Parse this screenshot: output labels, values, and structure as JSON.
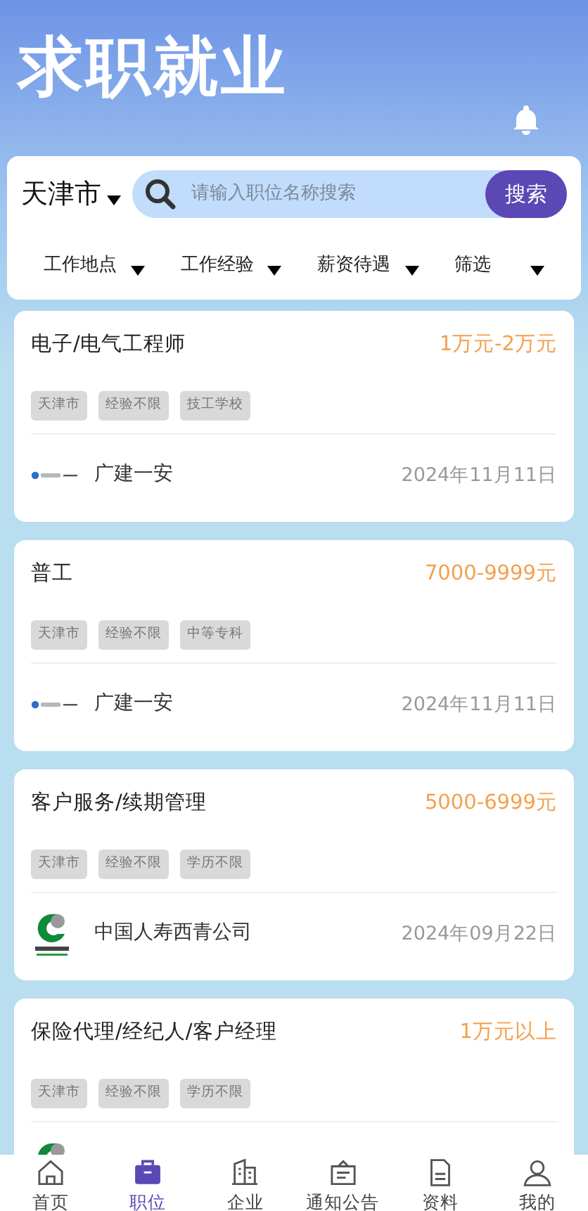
{
  "header": {
    "title": "求职就业"
  },
  "search": {
    "city": "天津市",
    "placeholder": "请输入职位名称搜索",
    "button": "搜索"
  },
  "filters": [
    {
      "label": "工作地点"
    },
    {
      "label": "工作经验"
    },
    {
      "label": "薪资待遇"
    },
    {
      "label": "筛选"
    }
  ],
  "jobs": [
    {
      "title": "电子/电气工程师",
      "salary": "1万元-2万元",
      "tags": [
        "天津市",
        "经验不限",
        "技工学校"
      ],
      "kind": "guangjian",
      "company": "广建一安",
      "date": "2024年11月11日"
    },
    {
      "title": "普工",
      "salary": "7000-9999元",
      "tags": [
        "天津市",
        "经验不限",
        "中等专科"
      ],
      "kind": "guangjian",
      "company": "广建一安",
      "date": "2024年11月11日"
    },
    {
      "title": "客户服务/续期管理",
      "salary": "5000-6999元",
      "tags": [
        "天津市",
        "经验不限",
        "学历不限"
      ],
      "kind": "chinalife",
      "company": "中国人寿西青公司",
      "date": "2024年09月22日"
    },
    {
      "title": "保险代理/经纪人/客户经理",
      "salary": "1万元以上",
      "tags": [
        "天津市",
        "经验不限",
        "学历不限"
      ],
      "kind": "chinalife"
    }
  ],
  "nav": [
    {
      "label": "首页",
      "kind": "home",
      "selected": false
    },
    {
      "label": "职位",
      "kind": "briefcase",
      "selected": true
    },
    {
      "label": "企业",
      "kind": "building",
      "selected": false
    },
    {
      "label": "通知公告",
      "kind": "notice",
      "selected": false
    },
    {
      "label": "资料",
      "kind": "document",
      "selected": false
    },
    {
      "label": "我的",
      "kind": "user",
      "selected": false
    }
  ]
}
